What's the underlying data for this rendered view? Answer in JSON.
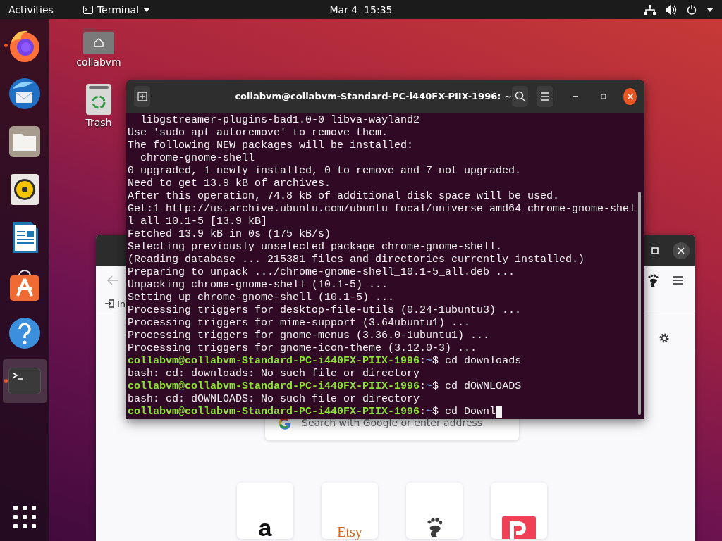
{
  "top_bar": {
    "activities": "Activities",
    "app_menu": "Terminal",
    "clock": "Mar 4  15:35"
  },
  "dock": {
    "items": [
      {
        "kind": "firefox",
        "running": true,
        "selected": false
      },
      {
        "kind": "thunderbird",
        "running": false,
        "selected": false
      },
      {
        "kind": "files",
        "running": false,
        "selected": false
      },
      {
        "kind": "rhythmbox",
        "running": false,
        "selected": false
      },
      {
        "kind": "writer",
        "running": false,
        "selected": false
      },
      {
        "kind": "software",
        "running": false,
        "selected": false
      },
      {
        "kind": "help",
        "running": false,
        "selected": false
      },
      {
        "kind": "terminal",
        "running": true,
        "selected": true
      }
    ]
  },
  "desktop_icons": [
    {
      "label": "collabvm",
      "kind": "home-folder"
    },
    {
      "label": "Trash",
      "kind": "trash"
    }
  ],
  "browser_window": {
    "bookmark": "In",
    "search": {
      "placeholder": "Search with Google or enter address"
    },
    "top_sites": [
      {
        "kind": "amazon",
        "logo_text": "a"
      },
      {
        "kind": "etsy",
        "logo_text": "Etsy"
      },
      {
        "kind": "gnome"
      },
      {
        "kind": "pocket"
      }
    ]
  },
  "terminal_window": {
    "title": "collabvm@collabvm-Standard-PC-i440FX-PIIX-1996: ~",
    "lines": [
      {
        "kind": "output",
        "text": "  libgstreamer-plugins-bad1.0-0 libva-wayland2"
      },
      {
        "kind": "output",
        "text": "Use 'sudo apt autoremove' to remove them."
      },
      {
        "kind": "output",
        "text": "The following NEW packages will be installed:"
      },
      {
        "kind": "output",
        "text": "  chrome-gnome-shell"
      },
      {
        "kind": "output",
        "text": "0 upgraded, 1 newly installed, 0 to remove and 7 not upgraded."
      },
      {
        "kind": "output",
        "text": "Need to get 13.9 kB of archives."
      },
      {
        "kind": "output",
        "text": "After this operation, 74.8 kB of additional disk space will be used."
      },
      {
        "kind": "output",
        "text": "Get:1 http://us.archive.ubuntu.com/ubuntu focal/universe amd64 chrome-gnome-shel"
      },
      {
        "kind": "output",
        "text": "l all 10.1-5 [13.9 kB]"
      },
      {
        "kind": "output",
        "text": "Fetched 13.9 kB in 0s (175 kB/s)"
      },
      {
        "kind": "output",
        "text": "Selecting previously unselected package chrome-gnome-shell."
      },
      {
        "kind": "output",
        "text": "(Reading database ... 215381 files and directories currently installed.)"
      },
      {
        "kind": "output",
        "text": "Preparing to unpack .../chrome-gnome-shell_10.1-5_all.deb ..."
      },
      {
        "kind": "output",
        "text": "Unpacking chrome-gnome-shell (10.1-5) ..."
      },
      {
        "kind": "output",
        "text": "Setting up chrome-gnome-shell (10.1-5) ..."
      },
      {
        "kind": "output",
        "text": "Processing triggers for desktop-file-utils (0.24-1ubuntu3) ..."
      },
      {
        "kind": "output",
        "text": "Processing triggers for mime-support (3.64ubuntu1) ..."
      },
      {
        "kind": "output",
        "text": "Processing triggers for gnome-menus (3.36.0-1ubuntu1) ..."
      },
      {
        "kind": "output",
        "text": "Processing triggers for gnome-icon-theme (3.12.0-3) ..."
      },
      {
        "kind": "prompt",
        "user_host": "collabvm@collabvm-Standard-PC-i440FX-PIIX-1996",
        "separator": ":",
        "path": "~",
        "command": "$ cd downloads",
        "cursor": false
      },
      {
        "kind": "output",
        "text": "bash: cd: downloads: No such file or directory"
      },
      {
        "kind": "prompt",
        "user_host": "collabvm@collabvm-Standard-PC-i440FX-PIIX-1996",
        "separator": ":",
        "path": "~",
        "command": "$ cd dOWNLOADS",
        "cursor": false
      },
      {
        "kind": "output",
        "text": "bash: cd: dOWNLOADS: No such file or directory"
      },
      {
        "kind": "prompt",
        "user_host": "collabvm@collabvm-Standard-PC-i440FX-PIIX-1996",
        "separator": ":",
        "path": "~",
        "command": "$ cd Downl",
        "cursor": true
      }
    ]
  }
}
